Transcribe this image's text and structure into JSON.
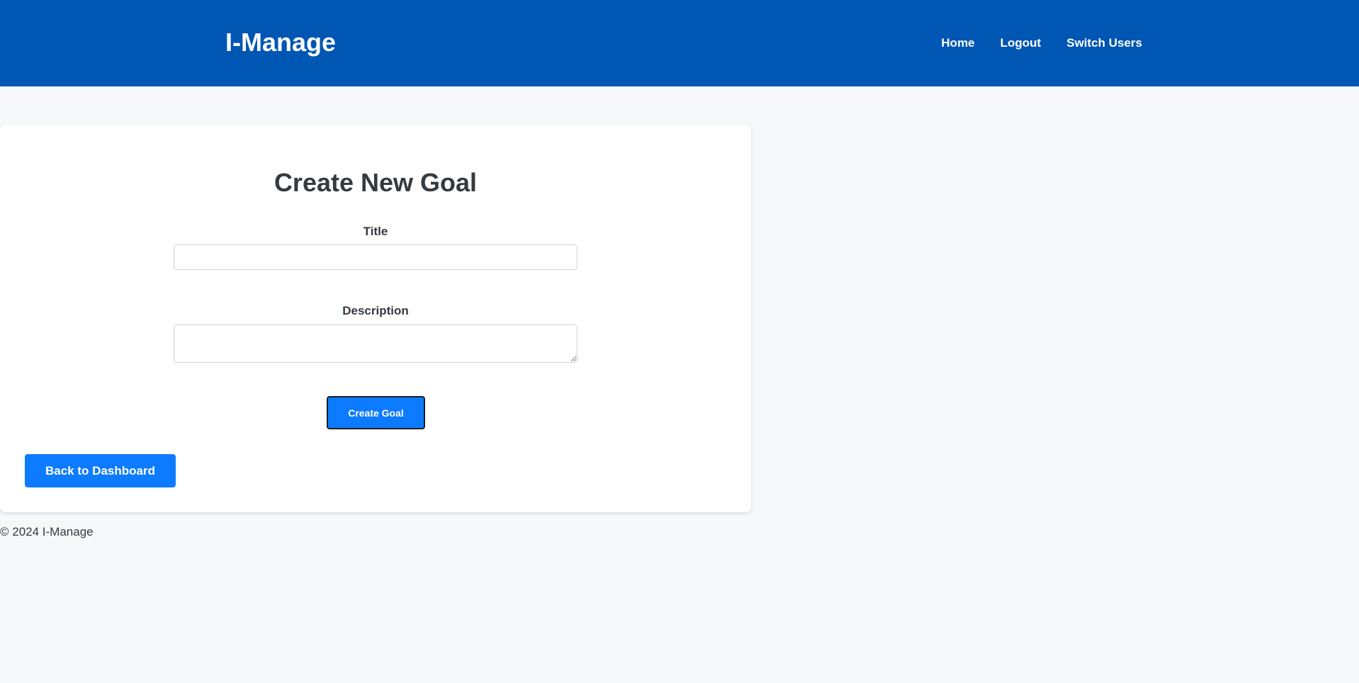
{
  "header": {
    "brand": "I-Manage",
    "nav": {
      "home": "Home",
      "logout": "Logout",
      "switch_users": "Switch Users"
    }
  },
  "form": {
    "title": "Create New Goal",
    "title_field": {
      "label": "Title",
      "value": "",
      "placeholder": ""
    },
    "description_field": {
      "label": "Description",
      "value": "",
      "placeholder": ""
    },
    "submit_label": "Create Goal",
    "back_label": "Back to Dashboard"
  },
  "footer": {
    "text": "© 2024 I-Manage"
  },
  "colors": {
    "header_bg": "#0056b3",
    "primary_button": "#0d7bff",
    "page_bg": "#f7f8fa",
    "card_bg": "#ffffff"
  }
}
